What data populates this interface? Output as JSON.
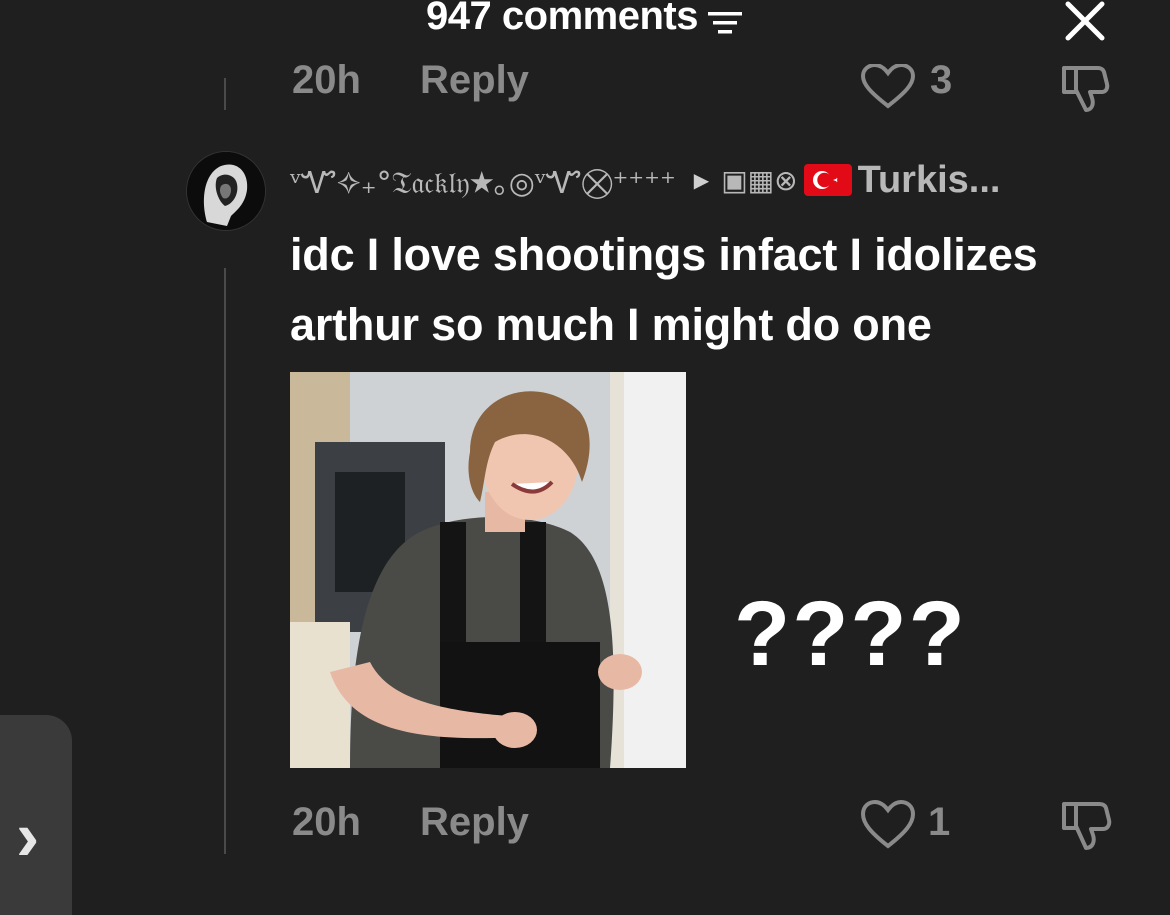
{
  "header": {
    "title": "947 comments",
    "sort_icon": "sort-lines-icon",
    "close_icon": "close-icon"
  },
  "previous_comment": {
    "time": "20h",
    "reply_label": "Reply",
    "likes": "3"
  },
  "comment": {
    "username_decoration": "ᵛᏉ✧₊°𝔗𝔞𝔠𝔨𝔩𝔶★｡◎ᵛᏉ⨂⁺⁺⁺⁺",
    "username_badges": "▣▦⊗",
    "username_text": "Turkis...",
    "text": "idc I love shootings infact I idolizes arthur so much I might do one",
    "image_caption": "????",
    "time": "20h",
    "reply_label": "Reply",
    "likes": "1"
  },
  "colors": {
    "background": "#1f1f1f",
    "primary_text": "#ffffff",
    "secondary_text": "#8a8a8a",
    "flag_red": "#e30a17"
  }
}
